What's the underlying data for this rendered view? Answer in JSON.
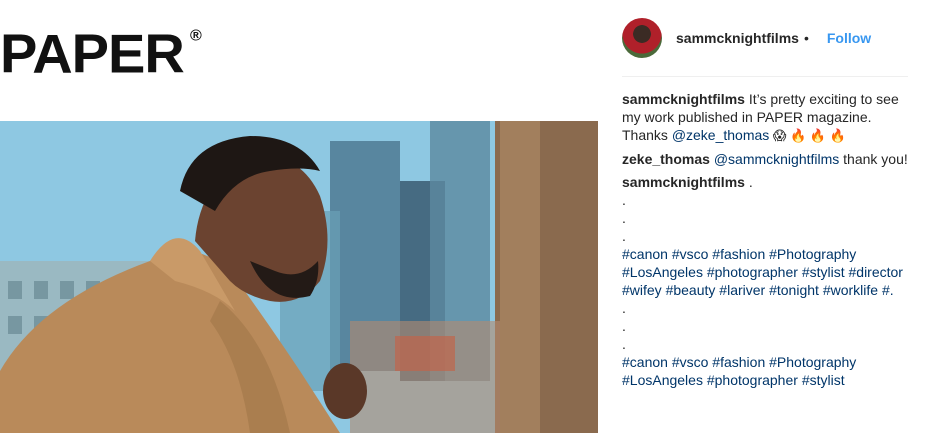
{
  "media": {
    "logo_text": "PAPER",
    "logo_mark": "®"
  },
  "header": {
    "username": "sammcknightfilms",
    "separator": "•",
    "follow_label": "Follow"
  },
  "comments": [
    {
      "username": "sammcknightfilms",
      "text_before": " It’s pretty exciting to see my work published in PAPER magazine. Thanks ",
      "mention": "@zeke_thomas",
      "emojis": " 😱 🔥 🔥 🔥"
    },
    {
      "username": "zeke_thomas",
      "mention": "@sammcknightfilms",
      "text_after": " thank you!"
    },
    {
      "username": "sammcknightfilms",
      "text_after": " .",
      "dots_a": [
        ".",
        ".",
        "."
      ],
      "hashtags_a": [
        "#canon",
        "#vsco",
        "#fashion",
        "#Photography",
        "#LosAngeles",
        "#photographer",
        "#stylist",
        "#director",
        "#wifey",
        "#beauty",
        "#lariver",
        "#tonight",
        "#worklife"
      ],
      "tail_a": " #.",
      "dots_b": [
        ".",
        ".",
        "."
      ],
      "hashtags_b": [
        "#canon",
        "#vsco",
        "#fashion",
        "#Photography",
        "#LosAngeles",
        "#photographer",
        "#stylist"
      ]
    }
  ],
  "colors": {
    "link": "#003569",
    "follow": "#3897f0",
    "text": "#262626"
  },
  "icons": {
    "avatar": "user-avatar"
  }
}
